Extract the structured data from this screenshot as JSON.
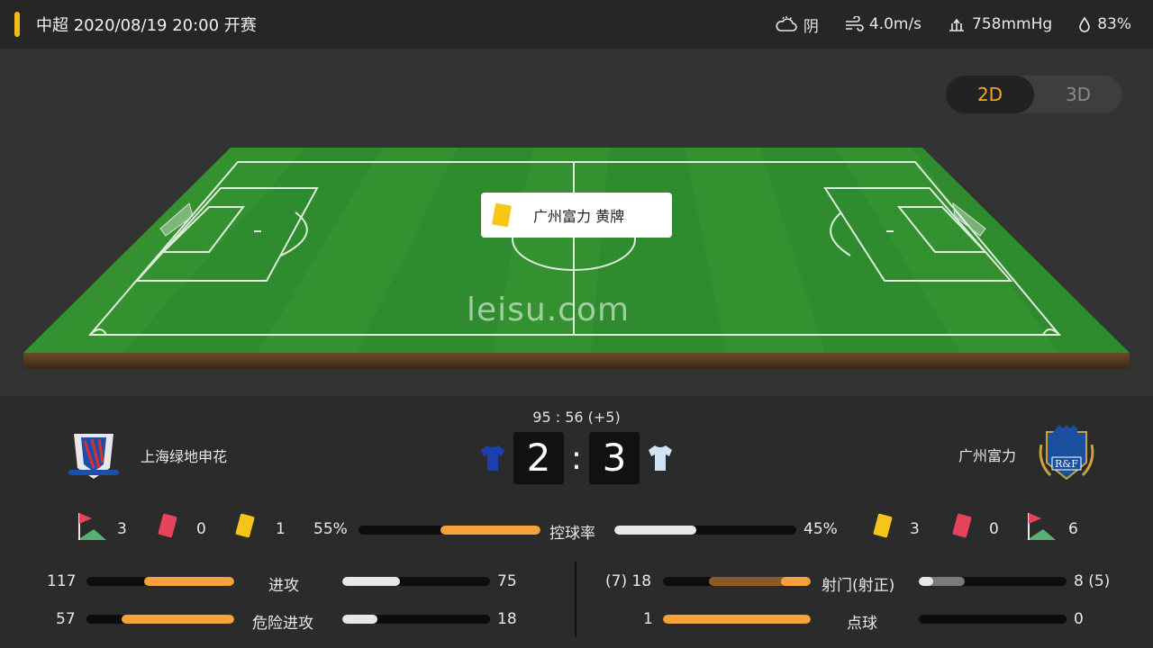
{
  "header": {
    "title": "中超 2020/08/19 20:00 开赛",
    "weather": "阴",
    "wind": "4.0m/s",
    "pressure": "758mmHg",
    "humidity": "83%"
  },
  "view_toggle": {
    "opt_2d": "2D",
    "opt_3d": "3D",
    "active": "2D"
  },
  "event_popup": {
    "text": "广州富力 黄牌",
    "card_color": "#f5c518"
  },
  "watermark": "leisu.com",
  "match": {
    "time": "95 : 56  (+5)",
    "home_name": "上海绿地申花",
    "away_name": "广州富力",
    "home_score": "2",
    "away_score": "3",
    "colon": ":"
  },
  "home_counts": {
    "corners": "3",
    "red": "0",
    "yellow": "1"
  },
  "away_counts": {
    "yellow": "3",
    "red": "0",
    "corners": "6"
  },
  "possession": {
    "label": "控球率",
    "home": "55%",
    "away": "45%",
    "home_frac": 0.55,
    "away_frac": 0.45
  },
  "stats_left": [
    {
      "label": "进攻",
      "home": "117",
      "away": "75",
      "home_frac": 0.61,
      "away_frac": 0.39
    },
    {
      "label": "危险进攻",
      "home": "57",
      "away": "18",
      "home_frac": 0.76,
      "away_frac": 0.24
    }
  ],
  "stats_right": [
    {
      "label": "射门(射正)",
      "home": "(7) 18",
      "away": "8 (5)",
      "home_frac": 0.69,
      "home_on_frac": 0.2,
      "away_frac": 0.31,
      "away_on_frac": 0.1
    },
    {
      "label": "点球",
      "home": "1",
      "away": "0",
      "home_frac": 1.0,
      "away_frac": 0.0
    }
  ],
  "colors": {
    "accent": "#f5b71c",
    "orange": "#f6a23b",
    "pitch": "#2e8b2e"
  }
}
